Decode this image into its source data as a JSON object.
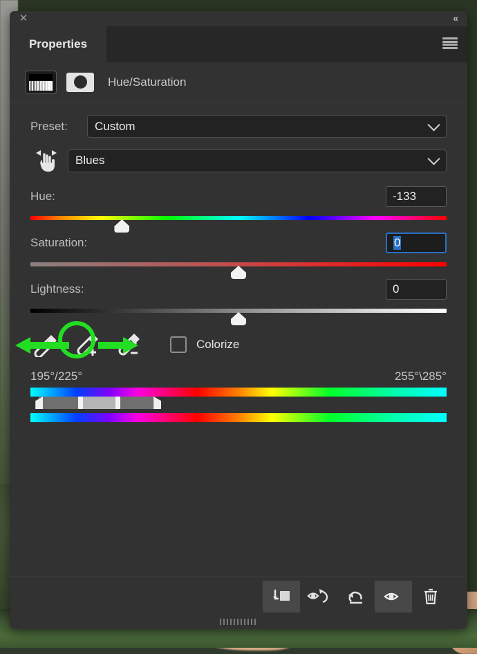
{
  "window": {
    "close_icon": "close-icon",
    "collapse_icon": "collapse-double-chevron-icon",
    "tab_label": "Properties",
    "menu_icon": "panel-menu-icon"
  },
  "header": {
    "adjustment_thumb_icon": "hue-saturation-adjustment-thumbnail",
    "mask_thumb_icon": "layer-mask-thumbnail",
    "title": "Hue/Saturation"
  },
  "preset": {
    "label": "Preset:",
    "value": "Custom",
    "chevron_icon": "chevron-down-icon"
  },
  "channel": {
    "scrubby_icon": "on-image-adjustment-hand-icon",
    "value": "Blues",
    "chevron_icon": "chevron-down-icon"
  },
  "sliders": [
    {
      "label": "Hue:",
      "value": "-133",
      "thumb_percent": 22,
      "focused": false
    },
    {
      "label": "Saturation:",
      "value": "0",
      "thumb_percent": 50,
      "focused": true
    },
    {
      "label": "Lightness:",
      "value": "0",
      "thumb_percent": 50,
      "focused": false
    }
  ],
  "hue": {
    "label": "Hue:",
    "value": "-133"
  },
  "saturation": {
    "label": "Saturation:",
    "value": "0"
  },
  "lightness": {
    "label": "Lightness:",
    "value": "0"
  },
  "tools": {
    "eyedropper_icon": "eyedropper-icon",
    "eyedropper_add_icon": "eyedropper-add-icon",
    "eyedropper_subtract_icon": "eyedropper-subtract-icon",
    "colorize_label": "Colorize",
    "colorize_checked": false,
    "checkbox_icon": "checkbox-unchecked-icon"
  },
  "range": {
    "left_label": "195°/225°",
    "right_label": "255°\\285°",
    "handles": {
      "outer_left_pct": 2,
      "inner_left_pct": 12,
      "inner_right_pct": 21,
      "outer_right_pct": 30
    }
  },
  "footer": {
    "buttons": [
      {
        "name": "clip-to-layer-button",
        "icon": "clip-to-layer-icon",
        "active": true
      },
      {
        "name": "view-previous-state-button",
        "icon": "eye-previous-state-icon",
        "active": false
      },
      {
        "name": "reset-button",
        "icon": "reset-arrow-icon",
        "active": false
      },
      {
        "name": "toggle-visibility-button",
        "icon": "eye-icon",
        "active": true
      },
      {
        "name": "delete-layer-button",
        "icon": "trash-icon",
        "active": false
      }
    ],
    "grip_icon": "resize-grip-icon"
  },
  "annotation": {
    "circle_color": "#22dd22",
    "arrow_left_icon": "arrow-left-annotation",
    "arrow_right_icon": "arrow-right-annotation"
  },
  "colors": {
    "panel_bg": "#323232",
    "tabbar_bg": "#272727",
    "field_bg": "#222222",
    "focus_blue": "#2a6fc4",
    "accent_green": "#22dd22"
  }
}
